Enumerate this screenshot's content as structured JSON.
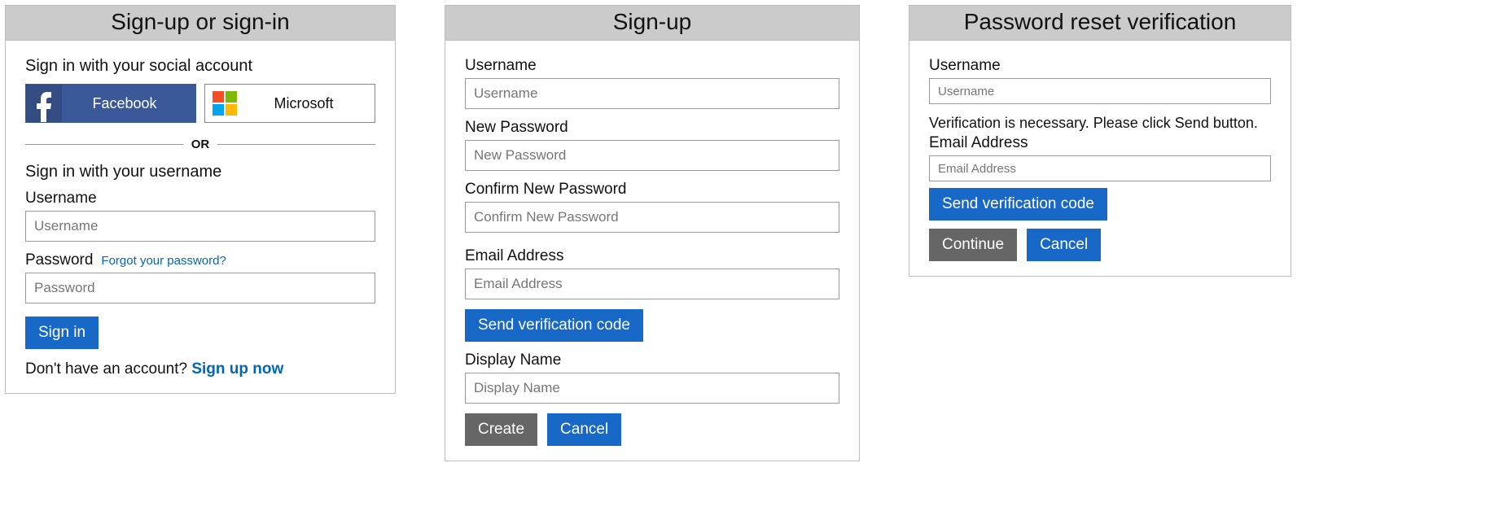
{
  "panel1": {
    "title": "Sign-up or sign-in",
    "social_title": "Sign in with your social account",
    "facebook_label": "Facebook",
    "microsoft_label": "Microsoft",
    "divider": "OR",
    "username_title": "Sign in with your username",
    "username_label": "Username",
    "username_placeholder": "Username",
    "password_label": "Password",
    "forgot_link": "Forgot your password?",
    "password_placeholder": "Password",
    "signin_button": "Sign in",
    "no_account_text": "Don't have an account? ",
    "signup_link": "Sign up now"
  },
  "panel2": {
    "title": "Sign-up",
    "username_label": "Username",
    "username_placeholder": "Username",
    "newpass_label": "New Password",
    "newpass_placeholder": "New Password",
    "confirm_label": "Confirm New Password",
    "confirm_placeholder": "Confirm New Password",
    "email_label": "Email Address",
    "email_placeholder": "Email Address",
    "send_code_button": "Send verification code",
    "display_label": "Display Name",
    "display_placeholder": "Display Name",
    "create_button": "Create",
    "cancel_button": "Cancel"
  },
  "panel3": {
    "title": "Password reset verification",
    "username_label": "Username",
    "username_placeholder": "Username",
    "verify_msg": "Verification is necessary. Please click Send button.",
    "email_label": "Email Address",
    "email_placeholder": "Email Address",
    "send_code_button": "Send verification code",
    "continue_button": "Continue",
    "cancel_button": "Cancel"
  }
}
